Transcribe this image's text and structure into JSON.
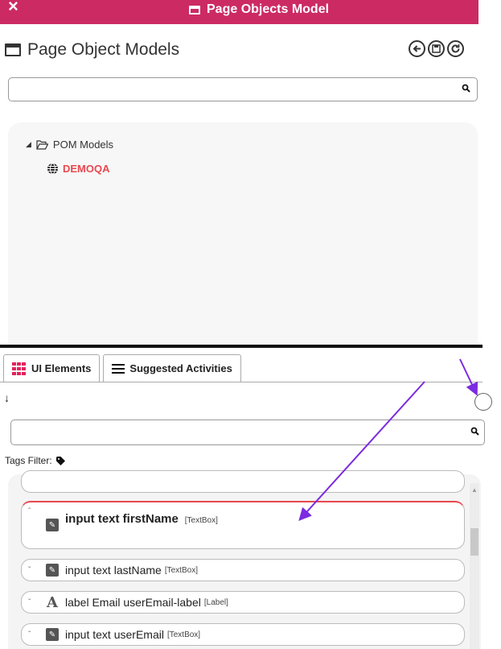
{
  "titlebar": {
    "close": "×",
    "title": "Page Objects Model"
  },
  "header": {
    "title": "Page Object Models"
  },
  "search": {
    "placeholder": ""
  },
  "tree": {
    "root_label": "POM Models",
    "child_label": "DEMOQA"
  },
  "tabs": [
    {
      "label": "UI Elements"
    },
    {
      "label": "Suggested Activities"
    }
  ],
  "tags_filter": {
    "label": "Tags Filter:"
  },
  "elements": [
    {
      "name": "input text firstName",
      "type": "[TextBox]"
    },
    {
      "name": "input text lastName",
      "type": "[TextBox]"
    },
    {
      "name": "label Email userEmail-label",
      "type": "[Label]"
    },
    {
      "name": "input text userEmail",
      "type": "[TextBox]"
    }
  ],
  "colors": {
    "accent": "#cc2a63",
    "highlight": "#e8484f",
    "annotation_arrow": "#7b2be0"
  }
}
